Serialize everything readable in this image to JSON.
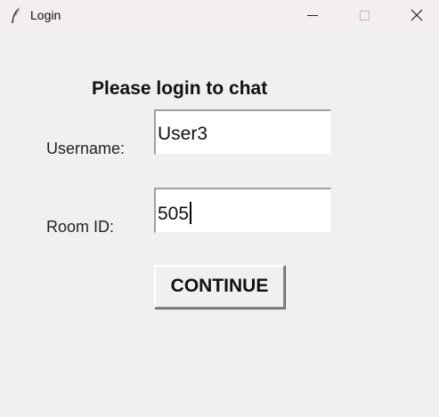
{
  "window": {
    "title": "Login",
    "icon": "feather-icon",
    "controls": [
      "minimize-icon",
      "maximize-icon",
      "close-icon"
    ]
  },
  "form": {
    "heading": "Please login to chat",
    "username_label": "Username:",
    "username_value": "User3",
    "room_label": "Room ID:",
    "room_value": "505",
    "continue_label": "CONTINUE"
  },
  "colors": {
    "background": "#f0f0f0",
    "titlebar": "#f3eef1",
    "field_bg": "#ffffff",
    "text": "#111111"
  }
}
